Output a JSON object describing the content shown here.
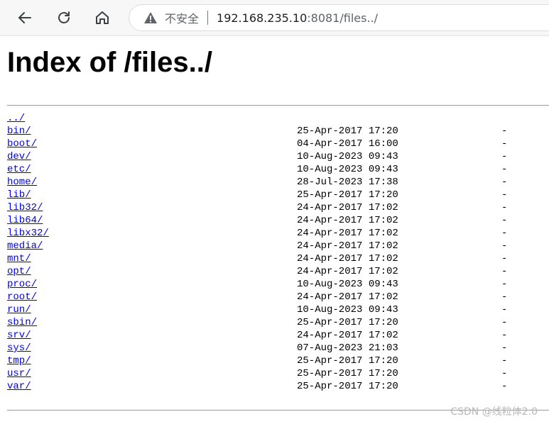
{
  "browser": {
    "security_label": "不安全",
    "url_host": "192.168.235.10",
    "url_rest": ":8081/files../"
  },
  "page": {
    "title": "Index of /files../"
  },
  "listing": {
    "parent": "../",
    "entries": [
      {
        "name": "bin/",
        "date": "25-Apr-2017 17:20",
        "size": "-"
      },
      {
        "name": "boot/",
        "date": "04-Apr-2017 16:00",
        "size": "-"
      },
      {
        "name": "dev/",
        "date": "10-Aug-2023 09:43",
        "size": "-"
      },
      {
        "name": "etc/",
        "date": "10-Aug-2023 09:43",
        "size": "-"
      },
      {
        "name": "home/",
        "date": "28-Jul-2023 17:38",
        "size": "-"
      },
      {
        "name": "lib/",
        "date": "25-Apr-2017 17:20",
        "size": "-"
      },
      {
        "name": "lib32/",
        "date": "24-Apr-2017 17:02",
        "size": "-"
      },
      {
        "name": "lib64/",
        "date": "24-Apr-2017 17:02",
        "size": "-"
      },
      {
        "name": "libx32/",
        "date": "24-Apr-2017 17:02",
        "size": "-"
      },
      {
        "name": "media/",
        "date": "24-Apr-2017 17:02",
        "size": "-"
      },
      {
        "name": "mnt/",
        "date": "24-Apr-2017 17:02",
        "size": "-"
      },
      {
        "name": "opt/",
        "date": "24-Apr-2017 17:02",
        "size": "-"
      },
      {
        "name": "proc/",
        "date": "10-Aug-2023 09:43",
        "size": "-"
      },
      {
        "name": "root/",
        "date": "24-Apr-2017 17:02",
        "size": "-"
      },
      {
        "name": "run/",
        "date": "10-Aug-2023 09:43",
        "size": "-"
      },
      {
        "name": "sbin/",
        "date": "25-Apr-2017 17:20",
        "size": "-"
      },
      {
        "name": "srv/",
        "date": "24-Apr-2017 17:02",
        "size": "-"
      },
      {
        "name": "sys/",
        "date": "07-Aug-2023 21:03",
        "size": "-"
      },
      {
        "name": "tmp/",
        "date": "25-Apr-2017 17:20",
        "size": "-"
      },
      {
        "name": "usr/",
        "date": "25-Apr-2017 17:20",
        "size": "-"
      },
      {
        "name": "var/",
        "date": "25-Apr-2017 17:20",
        "size": "-"
      }
    ]
  },
  "watermark": "CSDN @线粒体2.0",
  "colors": {
    "link": "#0000ee",
    "toolbar_bg": "#f7f7f7",
    "icon": "#3c4043"
  },
  "icons": {
    "back": "arrow-left-icon",
    "reload": "reload-icon",
    "home": "home-icon",
    "security": "warning-triangle-icon"
  }
}
